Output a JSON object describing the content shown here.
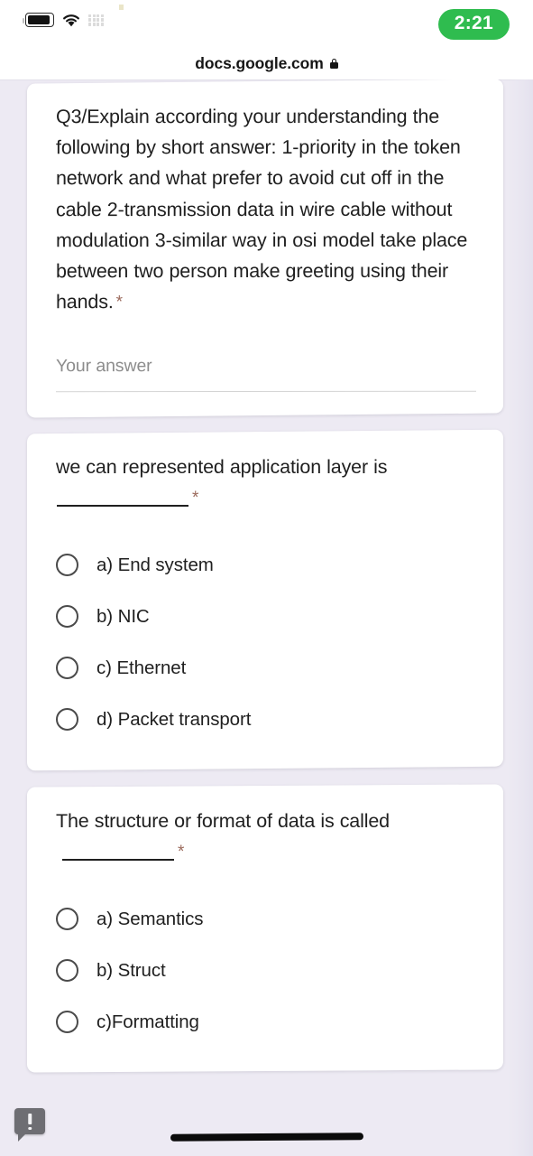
{
  "statusbar": {
    "battery_icon": "battery-full-icon",
    "wifi_icon": "wifi-icon",
    "signal_icon": "signal-grid-icon",
    "time_badge": "2:21"
  },
  "browser": {
    "url": "docs.google.com",
    "lock_icon": "lock-icon"
  },
  "form": {
    "questions": [
      {
        "id": "q3",
        "type": "short-answer",
        "text": "Q3/Explain according your understanding the following by short answer: 1-priority in the token network and what prefer to avoid cut off in the cable 2-transmission data in wire cable without modulation 3-similar way in osi model take place between two person make greeting using their hands.",
        "required_marker": "*",
        "answer_placeholder": "Your answer",
        "answer_value": ""
      },
      {
        "id": "q-app-layer",
        "type": "multiple-choice",
        "text_before_blank": "we can represented application layer is",
        "blank": "____________",
        "required_marker": "*",
        "options": [
          "a) End system",
          "b) NIC",
          "c) Ethernet",
          "d) Packet transport"
        ],
        "selected": null
      },
      {
        "id": "q-structure-format",
        "type": "multiple-choice",
        "text_before_blank": "The structure or format of data is called",
        "blank": "___________",
        "required_marker": "*",
        "options": [
          "a) Semantics",
          "b) Struct",
          "c)Formatting"
        ],
        "selected": null
      }
    ]
  },
  "overlay": {
    "alert_bubble_icon": "alert-bubble-icon",
    "home_indicator": "home-indicator"
  },
  "colors": {
    "page_background": "#edeaf3",
    "card_background": "#ffffff",
    "time_badge": "#2fbc4f",
    "required_asterisk": "#9c6b5d",
    "text_primary": "#1f1f1f",
    "placeholder": "#8d8d8d"
  }
}
